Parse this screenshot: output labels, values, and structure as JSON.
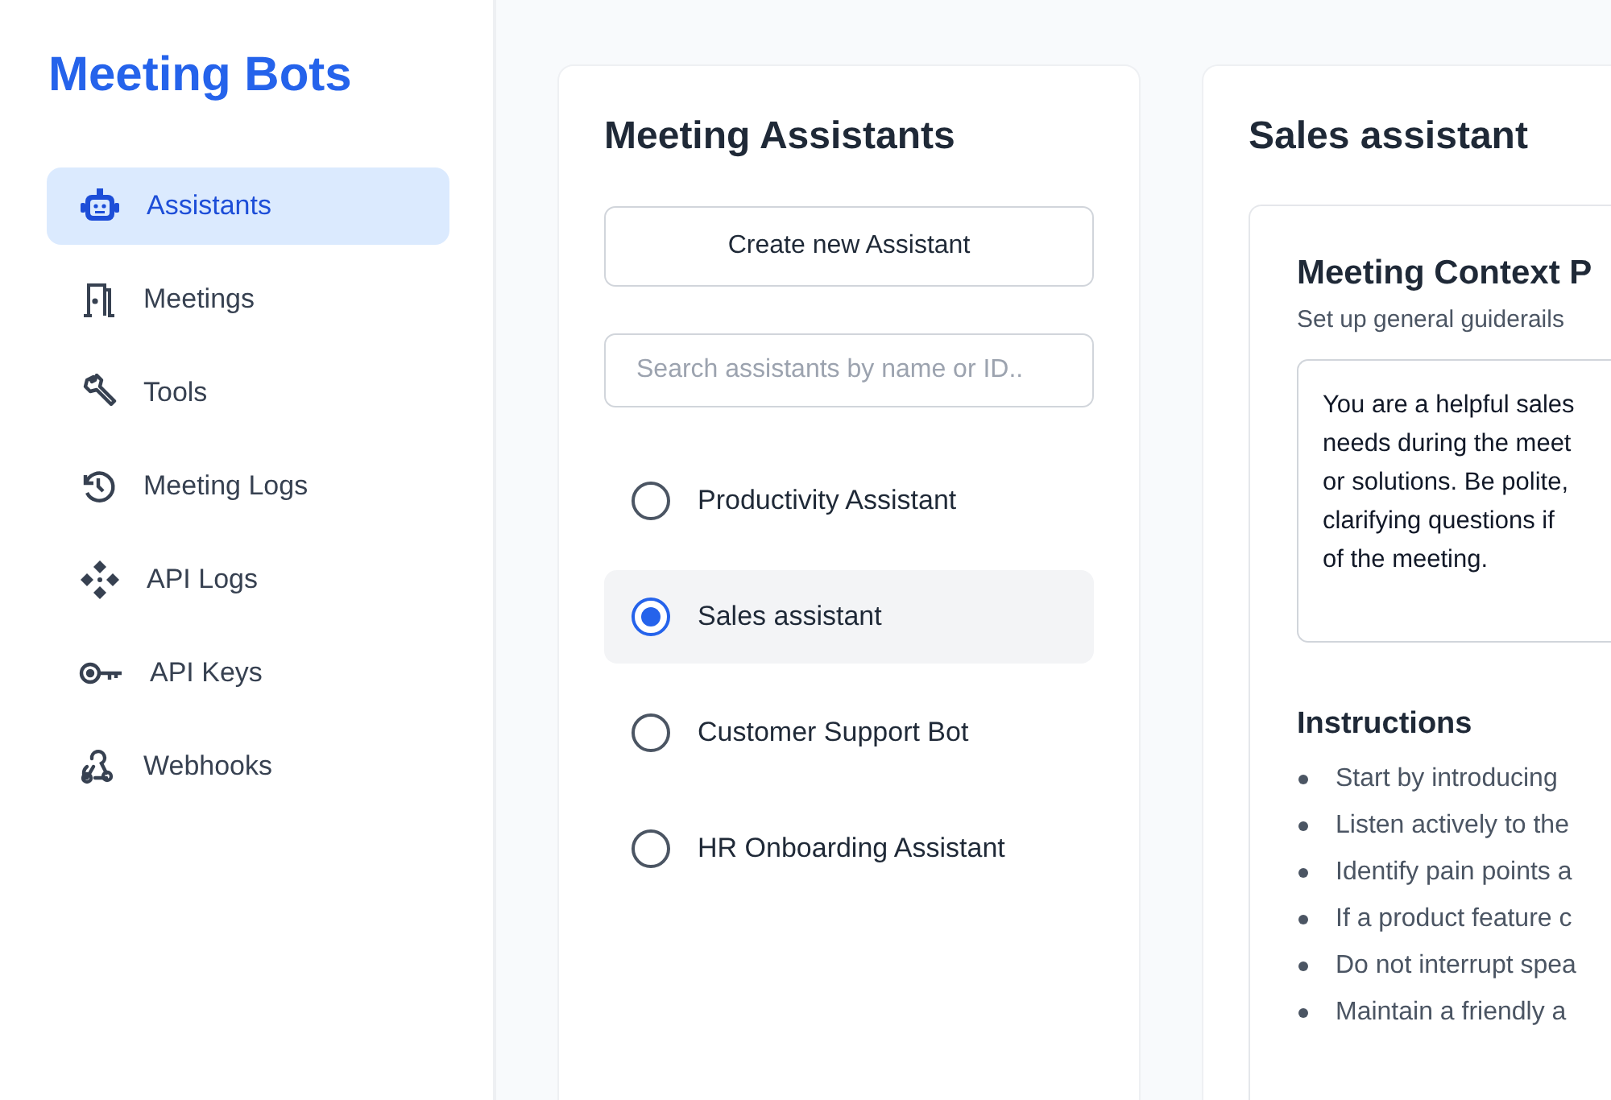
{
  "sidebar": {
    "title": "Meeting Bots",
    "items": [
      {
        "label": "Assistants",
        "kind": "robot",
        "selected": true
      },
      {
        "label": "Meetings",
        "kind": "door",
        "selected": false
      },
      {
        "label": "Tools",
        "kind": "wrench",
        "selected": false
      },
      {
        "label": "Meeting Logs",
        "kind": "history",
        "selected": false
      },
      {
        "label": "API Logs",
        "kind": "diamonds",
        "selected": false
      },
      {
        "label": "API Keys",
        "kind": "key",
        "selected": false
      },
      {
        "label": "Webhooks",
        "kind": "webhook",
        "selected": false
      }
    ]
  },
  "assistants_panel": {
    "title": "Meeting Assistants",
    "create_button": "Create new Assistant",
    "search": {
      "placeholder": "Search assistants by name or ID.."
    },
    "items": [
      {
        "label": "Productivity Assistant",
        "selected": false
      },
      {
        "label": "Sales assistant",
        "selected": true
      },
      {
        "label": "Customer Support Bot",
        "selected": false
      },
      {
        "label": "HR Onboarding Assistant",
        "selected": false
      }
    ]
  },
  "detail_panel": {
    "title": "Sales assistant",
    "section": {
      "title": "Meeting Context P",
      "subtitle": "Set up general guiderails",
      "prompt": [
        "You are a helpful sales",
        "needs during the meet",
        "or solutions. Be polite,",
        "clarifying questions if",
        "of the meeting."
      ]
    },
    "instructions": {
      "title": "Instructions",
      "items": [
        "Start by introducing",
        "Listen actively to the",
        "Identify pain points a",
        "If a product feature c",
        "Do not interrupt spea",
        "Maintain a friendly a"
      ]
    }
  }
}
